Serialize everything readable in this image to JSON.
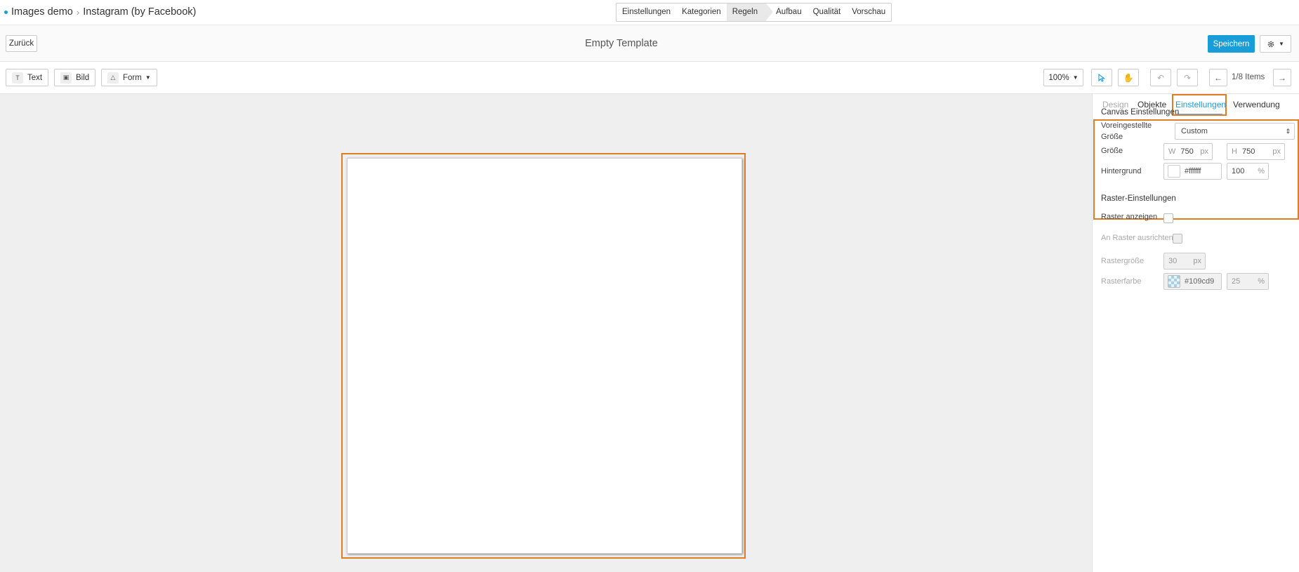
{
  "breadcrumb": {
    "project": "Images demo",
    "channel": "Instagram (by Facebook)"
  },
  "steps": [
    "Einstellungen",
    "Kategorien",
    "Regeln",
    "Aufbau",
    "Qualität",
    "Vorschau"
  ],
  "active_step": "Regeln",
  "header": {
    "back_label": "Zurück",
    "title": "Empty Template",
    "save_label": "Speichern"
  },
  "toolbar": {
    "text_label": "Text",
    "image_label": "Bild",
    "shape_label": "Form",
    "zoom": "100%",
    "pagination": "1/8 Items"
  },
  "panel": {
    "tabs": {
      "design": "Design",
      "objects": "Objekte",
      "settings": "Einstellungen",
      "usage": "Verwendung"
    },
    "canvas": {
      "title": "Canvas Einstellungen",
      "preset_label_1": "Voreingestellte",
      "preset_label_2": "Größe",
      "preset_value": "Custom",
      "size_label": "Größe",
      "width_prefix": "W",
      "width": "750",
      "height_prefix": "H",
      "height": "750",
      "unit": "px",
      "background_label": "Hintergrund",
      "background_color": "#ffffff",
      "background_opacity": "100",
      "percent": "%"
    },
    "grid": {
      "title": "Raster-Einstellungen",
      "show_label": "Raster anzeigen",
      "snap_label": "An Raster ausrichten",
      "size_label": "Rastergröße",
      "size_value": "30",
      "color_label": "Rasterfarbe",
      "color_value": "#109cd9",
      "opacity_value": "25"
    }
  },
  "colors": {
    "accent": "#189dd9",
    "highlight": "#e07b26"
  }
}
